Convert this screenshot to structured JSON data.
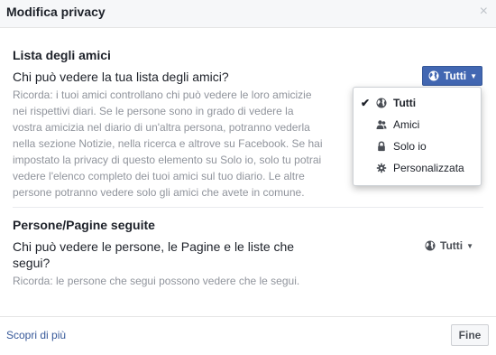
{
  "dialog": {
    "title": "Modifica privacy",
    "close_glyph": "×"
  },
  "friends_list": {
    "title": "Lista degli amici",
    "question": "Chi può vedere la tua lista degli amici?",
    "note": "Ricorda: i tuoi amici controllano chi può vedere le loro amicizie nei rispettivi diari. Se le persone sono in grado di vedere la vostra amicizia nel diario di un'altra persona, potranno vederla nella sezione Notizie, nella ricerca e altrove su Facebook. Se hai impostato la privacy di questo elemento su Solo io, solo tu potrai vedere l'elenco completo dei tuoi amici sul tuo diario. Le altre persone potranno vedere solo gli amici che avete in comune.",
    "privacy_button": {
      "label": "Tutti",
      "icon": "globe-icon",
      "color": "#4267b2"
    }
  },
  "privacy_menu": {
    "items": [
      {
        "label": "Tutti",
        "icon": "globe-icon",
        "selected": true
      },
      {
        "label": "Amici",
        "icon": "friends-icon",
        "selected": false
      },
      {
        "label": "Solo io",
        "icon": "lock-icon",
        "selected": false
      },
      {
        "label": "Personalizzata",
        "icon": "gear-icon",
        "selected": false
      }
    ]
  },
  "following": {
    "title": "Persone/Pagine seguite",
    "question": "Chi può vedere le persone, le Pagine e le liste che segui?",
    "note": "Ricorda: le persone che segui possono vedere che le segui.",
    "privacy_button": {
      "label": "Tutti",
      "icon": "globe-icon"
    }
  },
  "footer": {
    "learn_more": "Scopri di più",
    "done": "Fine"
  }
}
